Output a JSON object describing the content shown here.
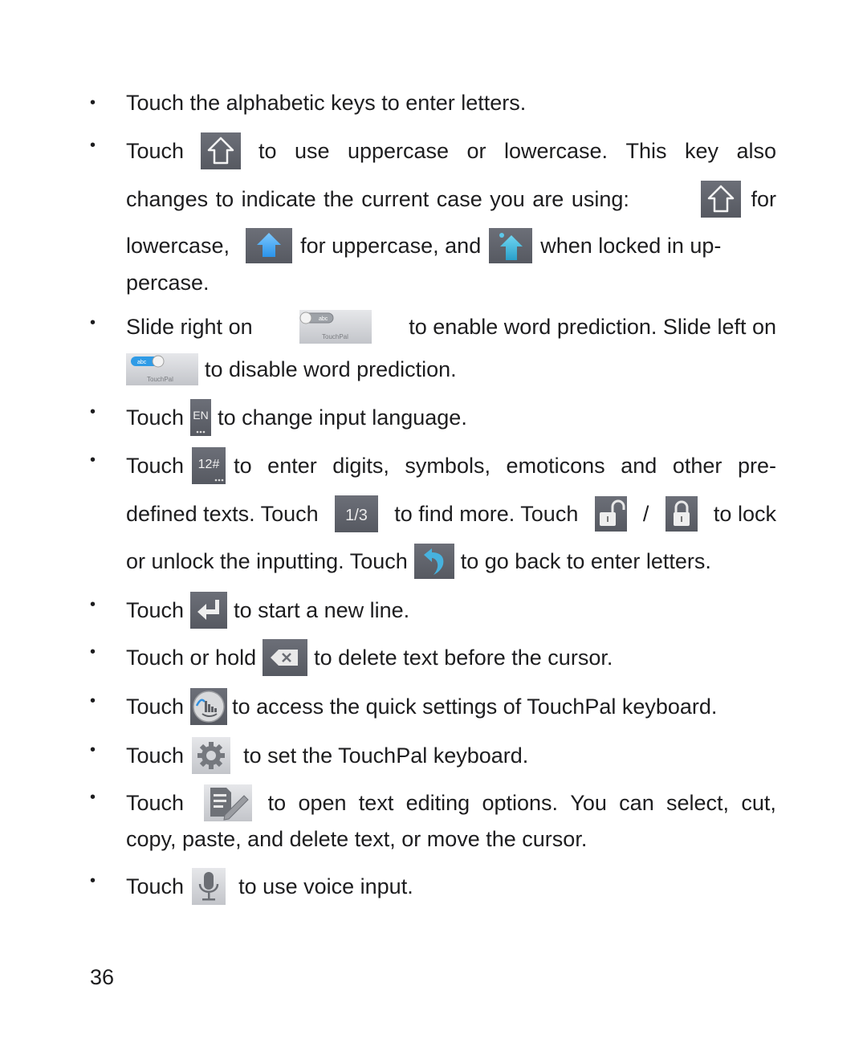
{
  "page_number": "36",
  "bullet_char": "•",
  "items": [
    {
      "lines": [
        [
          "Touch the alphabetic keys to enter letters."
        ]
      ]
    },
    {
      "lines": [
        [
          "Touch",
          "to",
          "use",
          "uppercase",
          "or",
          "lowercase.",
          "This",
          "key",
          "also"
        ],
        [
          "changes to indicate the current case you are using:",
          "for"
        ],
        [
          "lowercase,",
          "for uppercase, and",
          "when locked in up-"
        ],
        [
          "percase."
        ]
      ],
      "icons": {
        "shift": "shift-key-icon",
        "shift_lowercase": "shift-lowercase-icon",
        "shift_uppercase": "shift-uppercase-icon",
        "shift_locked": "shift-locked-icon"
      }
    },
    {
      "lines": [
        [
          "Slide right on",
          "to enable word prediction. Slide left on"
        ],
        [
          "to disable word prediction."
        ]
      ],
      "toggle_label": "abc",
      "toggle_brand": "TouchPal"
    },
    {
      "lines": [
        [
          "Touch",
          "to change input language."
        ]
      ],
      "lang_key_label": "EN"
    },
    {
      "lines": [
        [
          "Touch",
          "to enter digits, symbols, emoticons and other pre-"
        ],
        [
          "defined texts. Touch",
          "to find more. Touch",
          "/",
          "to lock"
        ],
        [
          "or unlock the inputting. Touch",
          "to go back to enter letters."
        ]
      ],
      "symbols_key_label": "12#",
      "page_key_label": "1/3"
    },
    {
      "lines": [
        [
          "Touch",
          "to start a new line."
        ]
      ]
    },
    {
      "lines": [
        [
          "Touch or hold",
          "to delete text before the cursor."
        ]
      ]
    },
    {
      "lines": [
        [
          "Touch",
          "to access the quick settings of TouchPal keyboard."
        ]
      ]
    },
    {
      "lines": [
        [
          "Touch",
          "to set the TouchPal keyboard."
        ]
      ]
    },
    {
      "lines": [
        [
          "Touch",
          "to",
          "open",
          "text",
          "editing",
          "options.",
          "You",
          "can",
          "select,",
          "cut,"
        ],
        [
          "copy, paste, and delete text, or move the cursor."
        ]
      ]
    },
    {
      "lines": [
        [
          "Touch",
          "to use voice input."
        ]
      ]
    }
  ],
  "colors": {
    "key_dark": "#5f626a",
    "accent_blue": "#3fa9f5",
    "accent_teal": "#3cb4d8",
    "text": "#1d1d1f"
  }
}
